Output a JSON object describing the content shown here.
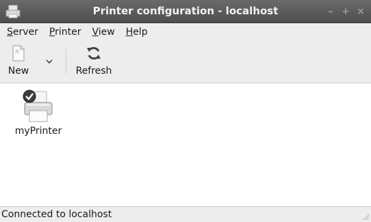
{
  "window": {
    "title": "Printer configuration - localhost",
    "app_icon": "printer-icon",
    "controls": [
      {
        "name": "minimize",
        "glyph": "–"
      },
      {
        "name": "maximize",
        "glyph": "+"
      },
      {
        "name": "close",
        "glyph": "×"
      }
    ]
  },
  "menubar": {
    "items": [
      {
        "first": "S",
        "rest": "erver"
      },
      {
        "first": "P",
        "rest": "rinter"
      },
      {
        "first": "V",
        "rest": "iew"
      },
      {
        "first": "H",
        "rest": "elp"
      }
    ]
  },
  "toolbar": {
    "new_label": "New",
    "new_icon": "new-document-icon",
    "dropdown_icon": "chevron-down-icon",
    "refresh_label": "Refresh",
    "refresh_icon": "refresh-icon"
  },
  "printers": [
    {
      "name": "myPrinter",
      "icon": "printer-icon",
      "status": "default"
    }
  ],
  "statusbar": {
    "text": "Connected to localhost"
  },
  "colors": {
    "titlebar": "#5a5a5a",
    "title_text": "#f2f2f2",
    "chrome": "#ededed",
    "content_bg": "#ffffff"
  }
}
